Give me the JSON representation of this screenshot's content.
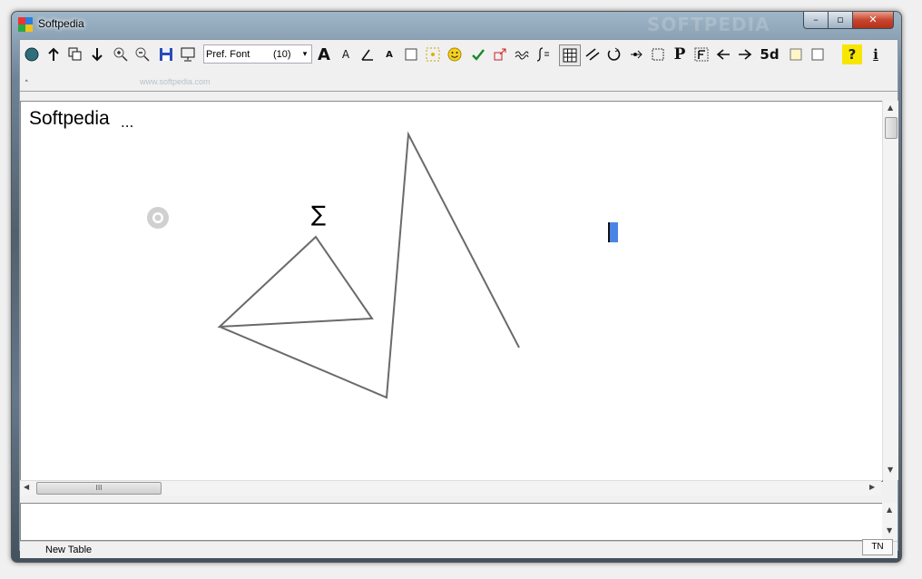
{
  "window": {
    "title": "Softpedia",
    "watermark": "SOFTPEDIA",
    "controls": {
      "minimize": "–",
      "maximize": "▫",
      "close": "✕"
    }
  },
  "toolbar": {
    "font_name": "Pref. Font",
    "font_size": "(10)",
    "dropdown_glyph": "▾",
    "sub_watermark": "www.softpedia.com",
    "icons": {
      "bigA": "A",
      "smallA": "A",
      "tinyA": "A",
      "p": "P",
      "five_d": "5d",
      "question": "?",
      "info": "i"
    }
  },
  "document": {
    "title": "Softpedia",
    "dots": "...",
    "sigma": "∑"
  },
  "scroll": {
    "h_thumb": "III"
  },
  "status": {
    "left": "New Table",
    "right": "TN"
  }
}
